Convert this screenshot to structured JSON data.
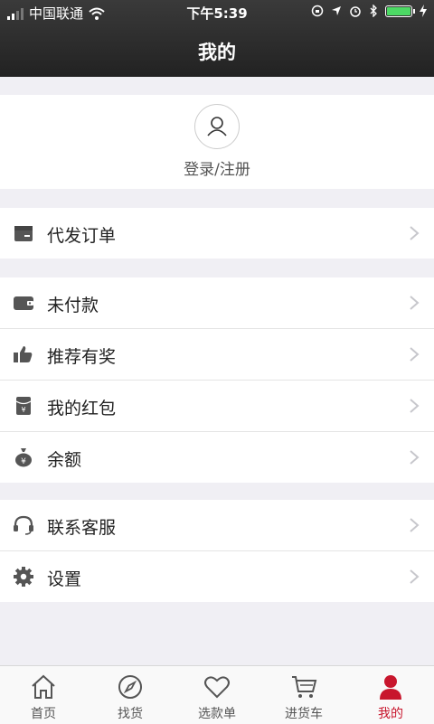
{
  "status_bar": {
    "carrier": "中国联通",
    "time": "下午5:39"
  },
  "header": {
    "title": "我的"
  },
  "login": {
    "label": "登录/注册"
  },
  "groups": [
    [
      {
        "label": "代发订单",
        "icon": "package-icon"
      }
    ],
    [
      {
        "label": "未付款",
        "icon": "wallet-icon"
      },
      {
        "label": "推荐有奖",
        "icon": "thumbs-up-icon"
      },
      {
        "label": "我的红包",
        "icon": "red-envelope-icon"
      },
      {
        "label": "余额",
        "icon": "money-bag-icon"
      }
    ],
    [
      {
        "label": "联系客服",
        "icon": "headset-icon"
      },
      {
        "label": "设置",
        "icon": "gear-icon"
      }
    ]
  ],
  "tabbar": [
    {
      "label": "首页",
      "icon": "home-icon"
    },
    {
      "label": "找货",
      "icon": "compass-icon"
    },
    {
      "label": "选款单",
      "icon": "heart-icon"
    },
    {
      "label": "进货车",
      "icon": "cart-icon"
    },
    {
      "label": "我的",
      "icon": "user-icon",
      "active": true
    }
  ],
  "colors": {
    "accent": "#c8162d",
    "header_bg": "#2b2b2b",
    "page_bg": "#f0eff4",
    "icon": "#555555"
  }
}
